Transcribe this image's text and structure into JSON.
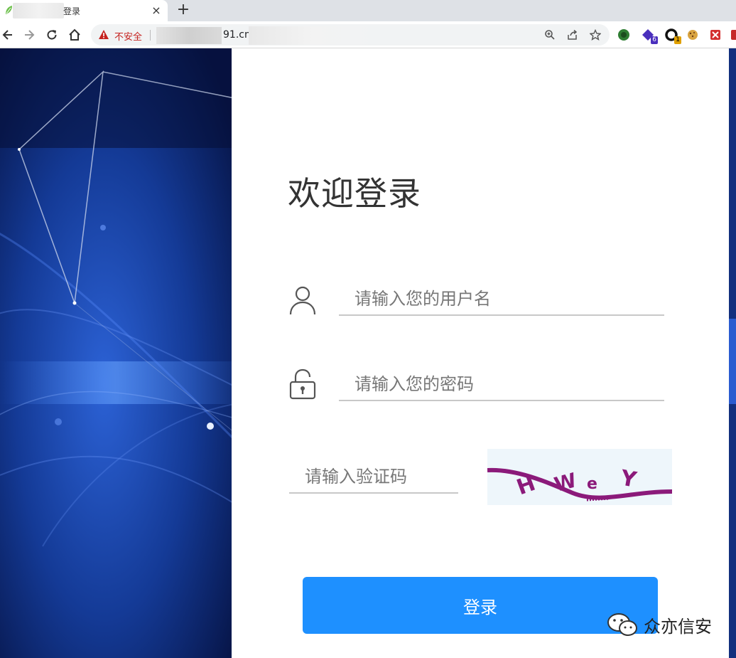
{
  "browser": {
    "tab": {
      "title": "登录",
      "close_glyph": "×"
    },
    "new_tab_glyph": "+",
    "security_label": "不安全",
    "url_visible": "91.cn/",
    "icons": [
      "back-icon",
      "forward-icon",
      "reload-icon",
      "home-icon",
      "warning-icon",
      "zoom-icon",
      "share-icon",
      "star-icon"
    ],
    "extensions": [
      {
        "name": "green-extension-icon",
        "badge": ""
      },
      {
        "name": "purple-extension-icon",
        "badge": "6"
      },
      {
        "name": "black-extension-icon",
        "badge": "1"
      },
      {
        "name": "cookie-extension-icon",
        "badge": ""
      },
      {
        "name": "red-extension-icon",
        "badge": ""
      }
    ]
  },
  "login": {
    "title": "欢迎登录",
    "username_placeholder": "请输入您的用户名",
    "password_placeholder": "请输入您的密码",
    "captcha_placeholder": "请输入验证码",
    "captcha_text": "HWeY",
    "submit_label": "登录"
  },
  "watermark": {
    "text": "众亦信安"
  },
  "colors": {
    "button": "#1e90ff",
    "bg_dark": "#0a1a4a",
    "bg_mid": "#1440a8",
    "captcha_ink": "#8b1a7a",
    "insecure": "#c5221f"
  }
}
